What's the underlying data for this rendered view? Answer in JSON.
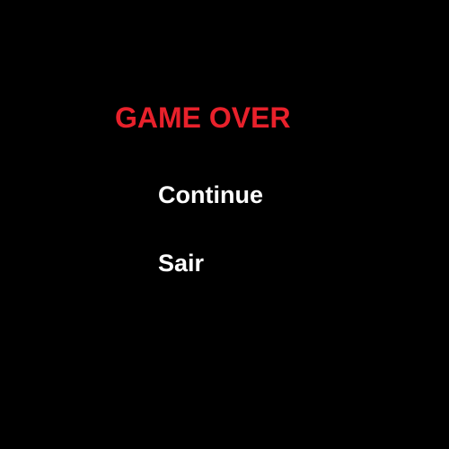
{
  "game_over": {
    "title": "GAME OVER",
    "menu": {
      "continue_label": "Continue",
      "exit_label": "Sair"
    }
  },
  "colors": {
    "background": "#000000",
    "title": "#e8212b",
    "menu_text": "#ffffff"
  }
}
